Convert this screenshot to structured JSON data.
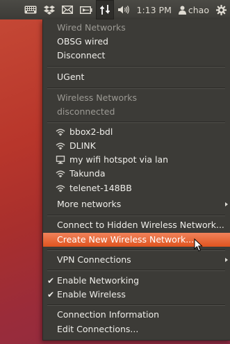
{
  "topbar": {
    "time": "1:13 PM",
    "user": "chao",
    "icons": [
      "keyboard-icon",
      "dropbox-icon",
      "mail-icon",
      "battery-icon",
      "network-icon",
      "volume-icon",
      "user-icon",
      "gear-icon"
    ]
  },
  "menu": {
    "wired_header": "Wired Networks",
    "wired_item": "OBSG wired",
    "disconnect": "Disconnect",
    "ugent": "UGent",
    "wireless_header": "Wireless Networks",
    "wireless_status": "disconnected",
    "networks": [
      {
        "label": "bbox2-bdl",
        "icon": "wifi-icon"
      },
      {
        "label": "DLINK",
        "icon": "wifi-icon"
      },
      {
        "label": "my wifi hotspot via lan",
        "icon": "monitor-icon"
      },
      {
        "label": "Takunda",
        "icon": "wifi-icon"
      },
      {
        "label": "telenet-148BB",
        "icon": "wifi-icon"
      }
    ],
    "more_networks": "More networks",
    "connect_hidden": "Connect to Hidden Wireless Network...",
    "create_new": "Create New Wireless Network...",
    "vpn": "VPN Connections",
    "enable_networking": "Enable Networking",
    "enable_wireless": "Enable Wireless",
    "connection_info": "Connection Information",
    "edit_connections": "Edit Connections...",
    "check_glyph": "✔",
    "highlight_color": "#e95420"
  }
}
